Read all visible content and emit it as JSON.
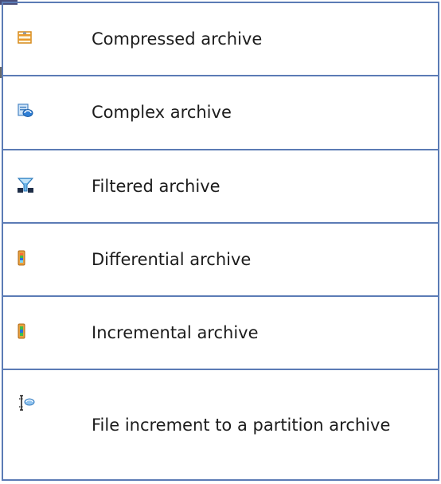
{
  "archive_types": [
    {
      "icon": "zip-archive-icon",
      "label": "Compressed archive"
    },
    {
      "icon": "complex-archive-icon",
      "label": "Complex archive"
    },
    {
      "icon": "funnel-icon",
      "label": "Filtered archive"
    },
    {
      "icon": "differential-archive-icon",
      "label": "Differential archive"
    },
    {
      "icon": "incremental-archive-icon",
      "label": "Incremental archive"
    },
    {
      "icon": "file-increment-partition-icon",
      "label": "File increment to a partition archive"
    }
  ],
  "colors": {
    "border": "#5b7bb5",
    "text": "#1c1c1c"
  }
}
